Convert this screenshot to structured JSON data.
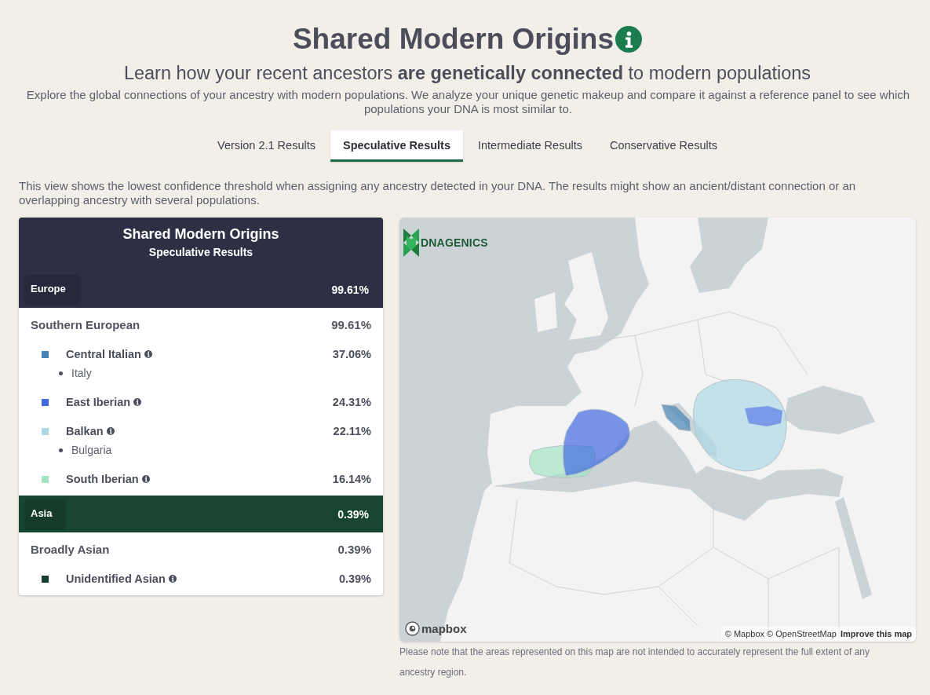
{
  "header": {
    "title": "Shared Modern Origins",
    "subtitle": "Learn how your recent ancestors **are genetically connected** to modern populations",
    "description": "Explore the global connections of your ancestry with modern populations. We analyze your unique genetic makeup and compare it against a reference panel to see which populations your DNA is most similar to."
  },
  "tabs": [
    {
      "label": "Version 2.1 Results",
      "selected": false
    },
    {
      "label": "Speculative Results",
      "selected": true
    },
    {
      "label": "Intermediate Results",
      "selected": false
    },
    {
      "label": "Conservative Results",
      "selected": false
    }
  ],
  "view_note": "This view shows the lowest confidence threshold when assigning any ancestry detected in your DNA. The results might show an ancient/distant connection or an overlapping ancestry with several populations.",
  "results_panel": {
    "title": "Shared Modern Origins",
    "subtitle": "Speculative Results",
    "regions": [
      {
        "name": "Europe",
        "percent": "99.61%",
        "color": "#2d2f45",
        "groups": [
          {
            "name": "Southern European",
            "percent": "99.61%",
            "populations": [
              {
                "name": "Central Italian",
                "percent": "37.06%",
                "color": "#4682b4",
                "countries": [
                  "Italy"
                ]
              },
              {
                "name": "East Iberian",
                "percent": "24.31%",
                "color": "#4169e1"
              },
              {
                "name": "Balkan",
                "percent": "22.11%",
                "color": "#add8e6",
                "countries": [
                  "Bulgaria"
                ]
              },
              {
                "name": "South Iberian",
                "percent": "16.14%",
                "color": "#a3e4c2"
              }
            ]
          }
        ]
      },
      {
        "name": "Asia",
        "percent": "0.39%",
        "color": "#17452f",
        "groups": [
          {
            "name": "Broadly Asian",
            "percent": "0.39%",
            "populations": [
              {
                "name": "Unidentified Asian",
                "percent": "0.39%",
                "color": "#173f2c"
              }
            ]
          }
        ]
      }
    ]
  },
  "map": {
    "logo_text": "DNAGENICS",
    "provider_logo_text": "mapbox",
    "attribution": "© Mapbox © OpenStreetMap",
    "improve_link": "Improve this map",
    "note": "Please note that the areas represented on this map are not intended to accurately represent the full extent of any ancestry region."
  }
}
